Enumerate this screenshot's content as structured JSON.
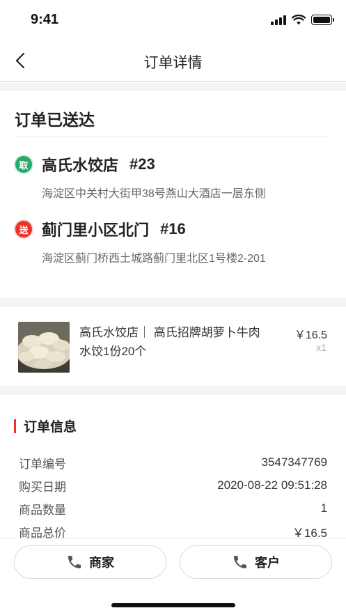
{
  "status_bar": {
    "time": "9:41"
  },
  "nav": {
    "title": "订单详情"
  },
  "delivery": {
    "status": "订单已送达",
    "pickup": {
      "badge": "取",
      "name": "高氏水饺店",
      "number": "#23",
      "address": "海淀区中关村大街甲38号燕山大酒店一层东侧"
    },
    "dropoff": {
      "badge": "送",
      "name": "蓟门里小区北门",
      "number": "#16",
      "address": "海淀区蓟门桥西土城路蓟门里北区1号楼2-201"
    }
  },
  "product": {
    "line1": "高氏水饺店｜ 高氏招牌胡萝卜牛肉",
    "line2": "水饺1份20个",
    "price": "￥16.5",
    "quantity": "x1"
  },
  "order_info": {
    "title": "订单信息",
    "rows": [
      {
        "label": "订单编号",
        "value": "3547347769"
      },
      {
        "label": "购买日期",
        "value": "2020-08-22 09:51:28"
      },
      {
        "label": "商品数量",
        "value": "1"
      },
      {
        "label": "商品总价",
        "value": "￥16.5"
      }
    ]
  },
  "actions": {
    "merchant_label": "商家",
    "customer_label": "客户"
  },
  "colors": {
    "accent": "#e8322c",
    "pickup_green": "#2aa96b",
    "divider": "#f4f4f4"
  }
}
